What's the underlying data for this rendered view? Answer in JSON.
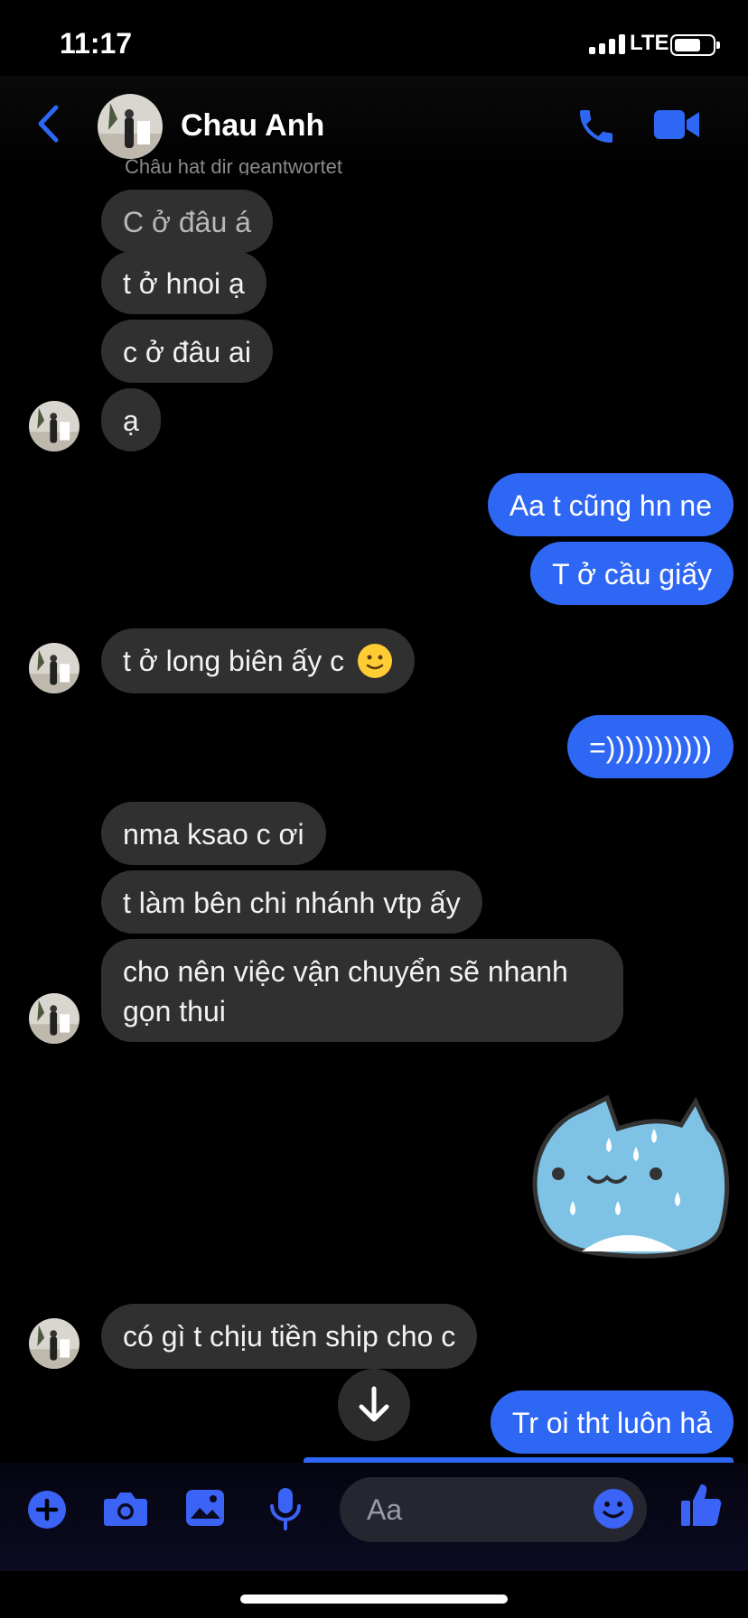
{
  "status": {
    "time": "11:17",
    "network": "LTE"
  },
  "header": {
    "contact_name": "Chau Anh",
    "reply_note": "Châu hat dir geantwortet"
  },
  "messages": {
    "m1": "C ở đâu á",
    "m2": "t ở hnoi ạ",
    "m3": "c ở đâu ai",
    "m4": "ạ",
    "m5": "Aa t cũng hn ne",
    "m6": "T ở cầu giấy",
    "m7": "t ở long biên ấy c",
    "m8": "=)))))))))))",
    "m9": "nma ksao c ơi",
    "m10": "t làm bên chi nhánh vtp ấy",
    "m11": "cho nên việc vận chuyển sẽ nhanh\ngọn thui",
    "m12": "có gì t chịu tiền ship cho c",
    "m13": "Tr oi tht luôn hả"
  },
  "composer": {
    "placeholder": "Aa"
  },
  "colors": {
    "accent": "#2f67f5",
    "incoming_bubble": "#303030",
    "background": "#000000"
  },
  "icons": [
    "back-chevron-icon",
    "phone-icon",
    "video-icon",
    "plus-icon",
    "camera-icon",
    "gallery-icon",
    "microphone-icon",
    "emoji-icon",
    "thumbs-up-icon",
    "arrow-down-icon",
    "sticker-cat"
  ]
}
